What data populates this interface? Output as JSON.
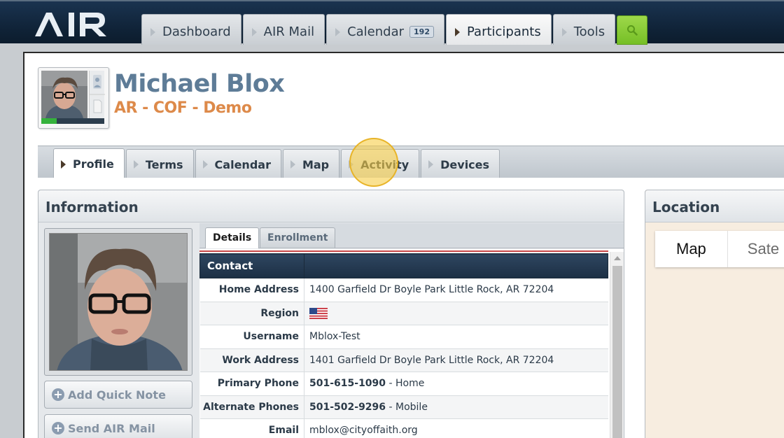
{
  "app": {
    "logo_text": "AIR"
  },
  "nav": {
    "tabs": [
      {
        "label": "Dashboard"
      },
      {
        "label": "AIR Mail"
      },
      {
        "label": "Calendar",
        "badge": "192"
      },
      {
        "label": "Participants",
        "active": true
      },
      {
        "label": "Tools"
      }
    ]
  },
  "person": {
    "name": "Michael Blox",
    "organization": "AR - COF - Demo"
  },
  "profile_tabs": [
    {
      "label": "Profile",
      "active": true
    },
    {
      "label": "Terms"
    },
    {
      "label": "Calendar"
    },
    {
      "label": "Map"
    },
    {
      "label": "Activity"
    },
    {
      "label": "Devices"
    }
  ],
  "info": {
    "title": "Information",
    "buttons": {
      "quick_note": "Add Quick Note",
      "send_mail": "Send AIR Mail"
    },
    "subtabs": {
      "details": "Details",
      "enrollment": "Enrollment"
    },
    "contact_header": "Contact",
    "rows": {
      "home_address": {
        "label": "Home Address",
        "value": "1400 Garfield Dr Boyle Park Little Rock, AR 72204"
      },
      "region": {
        "label": "Region",
        "value": "us-flag-icon"
      },
      "username": {
        "label": "Username",
        "value": "Mblox-Test"
      },
      "work_address": {
        "label": "Work Address",
        "value": "1401 Garfield Dr Boyle Park Little Rock, AR 72204"
      },
      "primary_phone": {
        "label": "Primary Phone",
        "number": "501-615-1090",
        "type": "- Home"
      },
      "alternate_phones": {
        "label": "Alternate Phones",
        "number": "501-502-9296",
        "type": "- Mobile"
      },
      "email": {
        "label": "Email",
        "value": "mblox@cityoffaith.org"
      }
    }
  },
  "location": {
    "title": "Location",
    "map_type": {
      "map": "Map",
      "satellite": "Sate"
    }
  },
  "colors": {
    "accent_green": "#76bf26",
    "name_blue": "#5e7c97",
    "org_orange": "#dd8a4a",
    "header_navy": "#0f2236"
  }
}
